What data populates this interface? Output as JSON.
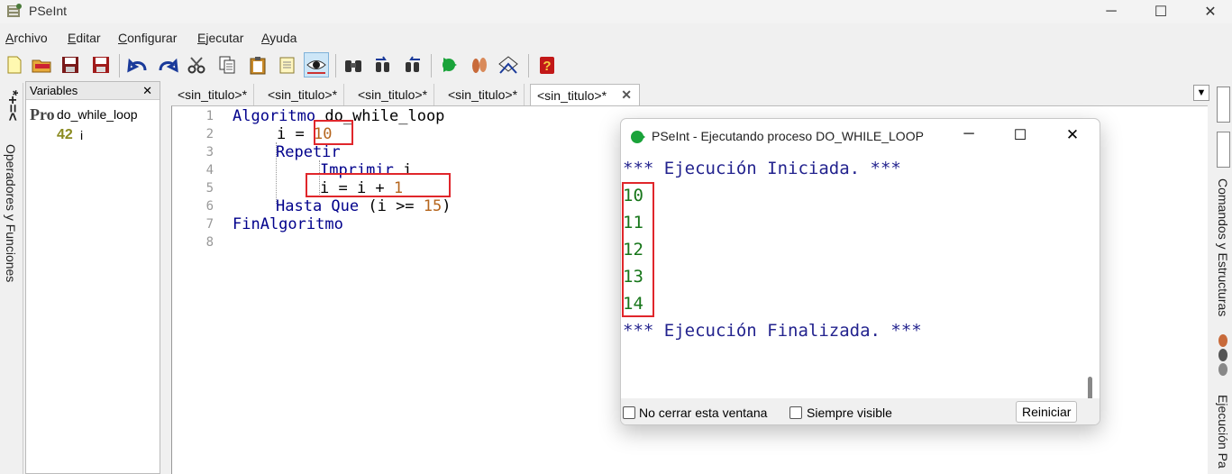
{
  "window": {
    "title": "PSeInt",
    "controls": [
      "minimize-icon",
      "maximize-icon",
      "close-icon"
    ]
  },
  "menu": {
    "items": [
      {
        "first": "A",
        "rest": "rchivo"
      },
      {
        "first": "E",
        "rest": "ditar"
      },
      {
        "first": "C",
        "rest": "onfigurar"
      },
      {
        "first": "E",
        "rest": "jecutar"
      },
      {
        "first": "A",
        "rest": "yuda"
      }
    ]
  },
  "toolbar": {
    "icons": [
      "new-file-icon",
      "open-folder-icon",
      "save-icon",
      "save-as-icon",
      "undo-icon",
      "redo-icon",
      "cut-icon",
      "copy-icon",
      "paste-icon",
      "edit-icon",
      "variables-view-icon",
      "find-icon",
      "find-next-icon",
      "find-previous-icon",
      "run-icon",
      "step-by-step-icon",
      "draw-flowchart-icon",
      "help-icon"
    ]
  },
  "left_panel": {
    "vertical_label": "Operadores y Funciones",
    "variables": {
      "header": "Variables",
      "close": "✕",
      "program_badge": "Pro",
      "program_name": "do_while_loop",
      "var_badge": "42",
      "var_name": "i"
    }
  },
  "editor": {
    "tabs": [
      "<sin_titulo>*",
      "<sin_titulo>*",
      "<sin_titulo>*",
      "<sin_titulo>*",
      "<sin_titulo>*"
    ],
    "active_tab_close": "✕",
    "line_numbers": [
      "1",
      "2",
      "3",
      "4",
      "5",
      "6",
      "7",
      "8"
    ],
    "lines": {
      "l1_kw": "Algoritmo",
      "l1_name": " do_while_loop",
      "l2_a": "i = ",
      "l2_num": "10",
      "l3_kw": "Repetir",
      "l4_kw": "Imprimir",
      "l4_rest": " i",
      "l5_a": "i = i + ",
      "l5_num": "1",
      "l6_kw": "Hasta Que",
      "l6_a": " (i >= ",
      "l6_num": "15",
      "l6_b": ")",
      "l7_kw": "FinAlgoritmo"
    }
  },
  "right_panel": {
    "labels": [
      "Comandos y Estructuras",
      "Ejecución Pa"
    ]
  },
  "run_dialog": {
    "title": "PSeInt - Ejecutando proceso DO_WHILE_LOOP",
    "console": {
      "start": "*** Ejecución Iniciada. ***",
      "outputs": [
        "10",
        "11",
        "12",
        "13",
        "14"
      ],
      "end": "*** Ejecución Finalizada. ***"
    },
    "footer": {
      "keep_open": "No cerrar esta ventana",
      "always_visible": "Siempre visible",
      "restart": "Reiniciar"
    }
  }
}
